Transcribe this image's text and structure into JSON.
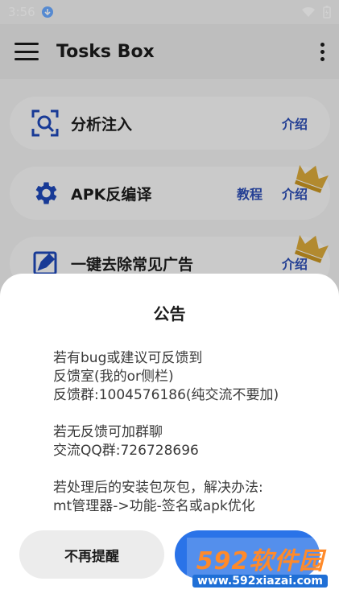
{
  "status": {
    "time": "3:56"
  },
  "toolbar": {
    "title": "Tosks Box"
  },
  "cards": [
    {
      "label": "分析注入",
      "actions": [
        "介绍"
      ]
    },
    {
      "label": "APK反编译",
      "actions": [
        "教程",
        "介绍"
      ]
    },
    {
      "label": "一键去除常见广告",
      "actions": [
        "介绍"
      ]
    }
  ],
  "dialog": {
    "title": "公告",
    "lines": [
      "若有bug或建议可反馈到",
      "反馈室(我的or侧栏)",
      "反馈群:1004576186(纯交流不要加)",
      "",
      "若无反馈可加群聊",
      "交流QQ群:726728696",
      "",
      "若处理后的安装包灰包，解决办法:",
      "mt管理器->功能-签名或apk优化"
    ],
    "dismiss_button": "不再提醒"
  },
  "watermark": {
    "main": "592软件园",
    "sub": "www.592xiazai.com"
  },
  "icons": {
    "download": "download-icon",
    "wifi": "wifi-icon",
    "battery": "battery-icon",
    "menu": "menu-icon",
    "more": "more-vert-icon",
    "analyze": "scan-search-icon",
    "settings": "gear-icon",
    "edit": "edit-box-icon",
    "crown": "crown-icon"
  },
  "colors": {
    "accent": "#2e4fb5",
    "primary_button": "#2a73e8",
    "icon_blue": "#1e47b8"
  }
}
